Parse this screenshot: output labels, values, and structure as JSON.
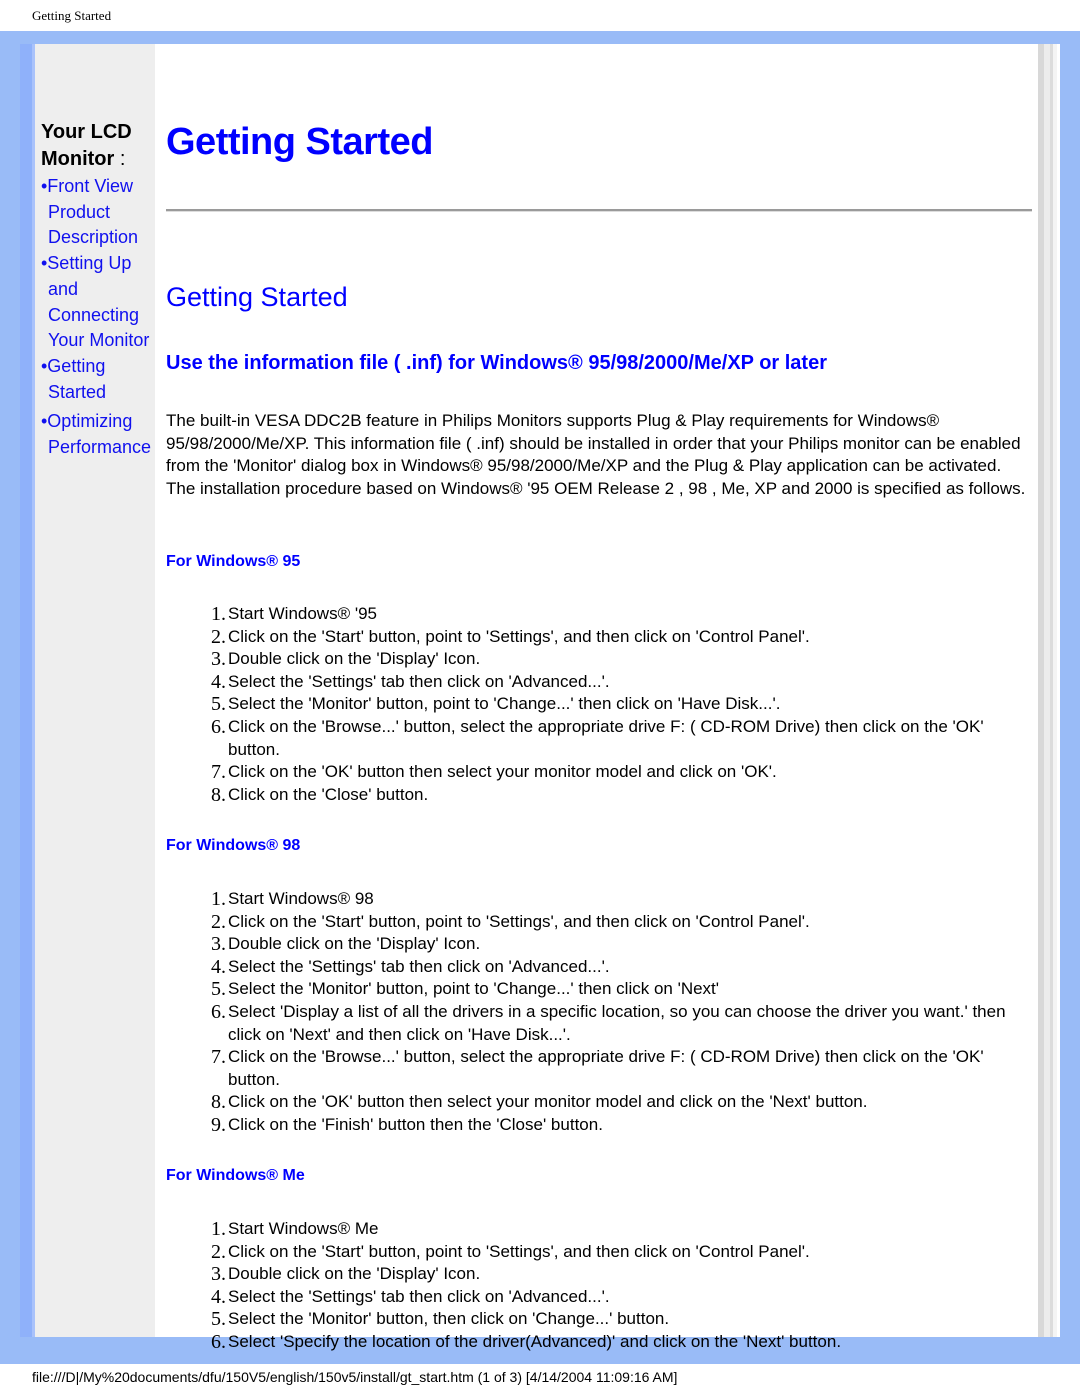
{
  "page": {
    "header_title": "Getting Started",
    "footer_path": "file:///D|/My%20documents/dfu/150V5/english/150v5/install/gt_start.htm (1 of 3) [4/14/2004 11:09:16 AM]"
  },
  "sidebar": {
    "title_line1": "Your LCD",
    "title_line2": "Monitor",
    "title_colon": " :",
    "items": [
      {
        "label_lines": [
          "•Front View",
          "Product",
          "Description"
        ]
      },
      {
        "label_lines": [
          "•Setting Up",
          "and",
          "Connecting",
          "Your Monitor"
        ]
      },
      {
        "label_lines": [
          "•Getting",
          "Started"
        ]
      },
      {
        "label_lines": [
          "•Optimizing",
          "Performance"
        ]
      }
    ]
  },
  "main": {
    "title": "Getting Started",
    "subtitle": "Getting Started",
    "section_heading": "Use the information file ( .inf) for Windows® 95/98/2000/Me/XP or later",
    "intro": "The built-in VESA DDC2B feature in Philips Monitors supports Plug & Play requirements for Windows® 95/98/2000/Me/XP. This information file ( .inf) should be installed in order that your Philips monitor can be enabled from the 'Monitor' dialog box in Windows® 95/98/2000/Me/XP and the Plug & Play application can be activated. The installation procedure based on Windows® '95 OEM Release 2 , 98 , Me, XP and 2000 is specified as follows.",
    "sections": [
      {
        "label": "For Windows® 95",
        "steps": [
          "Start Windows® '95",
          "Click on the 'Start' button, point to 'Settings', and then click on 'Control Panel'.",
          "Double click on the 'Display' Icon.",
          "Select the 'Settings' tab then click on 'Advanced...'.",
          "Select the 'Monitor' button, point to 'Change...' then click on 'Have Disk...'.",
          "Click on the 'Browse...' button, select the appropriate drive F: ( CD-ROM Drive) then click on the 'OK' button.",
          "Click on the 'OK' button then select your monitor model and click on 'OK'.",
          "Click on the 'Close' button."
        ]
      },
      {
        "label": "For Windows® 98",
        "steps": [
          "Start Windows® 98",
          "Click on the 'Start' button, point to 'Settings', and then click on 'Control Panel'.",
          "Double click on the 'Display' Icon.",
          "Select the 'Settings' tab then click on 'Advanced...'.",
          "Select the 'Monitor' button, point to 'Change...' then click on 'Next'",
          "Select 'Display a list of all the drivers in a specific location, so you can choose the driver you want.' then click on 'Next' and then click on 'Have Disk...'.",
          "Click on the 'Browse...' button, select the appropriate drive F: ( CD-ROM Drive) then click on the 'OK' button.",
          "Click on the 'OK' button then select your monitor model and click on the 'Next' button.",
          "Click on the 'Finish' button then the 'Close' button."
        ]
      },
      {
        "label": "For Windows® Me",
        "steps": [
          "Start Windows® Me",
          "Click on the 'Start' button, point to 'Settings', and then click on 'Control Panel'.",
          "Double click on the 'Display' Icon.",
          "Select the 'Settings' tab then click on 'Advanced...'.",
          "Select the 'Monitor' button, then click on 'Change...' button.",
          "Select 'Specify the location of the driver(Advanced)' and click on the 'Next' button."
        ]
      }
    ]
  },
  "colors": {
    "frame": "#99bbf7",
    "sidebar_bg": "#eeeeee",
    "link": "#1010ee",
    "heading": "#0000ff"
  }
}
